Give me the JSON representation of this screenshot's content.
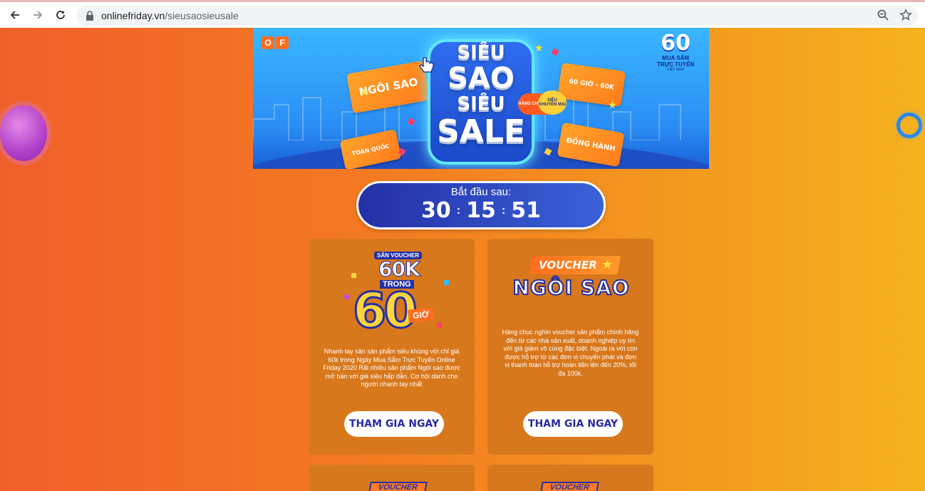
{
  "browser": {
    "url_host": "onlinefriday.vn",
    "url_path": "/sieusaosieusale",
    "icons": [
      "back-icon",
      "forward-icon",
      "reload-icon",
      "lock-icon",
      "zoom-icon",
      "star-icon"
    ]
  },
  "hero": {
    "title_line1": "SIÊU",
    "title_line2": "SAO",
    "title_line3": "SIÊU",
    "title_line4": "SALE",
    "ticket_1": "NGÔI SAO",
    "ticket_2": "60 GIỜ - 60K",
    "ticket_3": "TOÀN QUỐC",
    "ticket_4": "ĐỒNG HÀNH",
    "badge_1": "HÀNG CHÍNH HÃNG",
    "badge_2": "SIÊU KHUYẾN MẠI",
    "logo_of": [
      "O",
      "F"
    ],
    "logo_60": "60",
    "logo_60_sub1": "MUA SẮM",
    "logo_60_sub2": "TRỰC TUYẾN",
    "logo_60_sub3": "VIỆT NAM"
  },
  "countdown": {
    "label": "Bắt đầu sau:",
    "hours": "30",
    "minutes": "15",
    "seconds": "51",
    "separator": ":"
  },
  "cards": [
    {
      "logo_top": "SĂN VOUCHER",
      "logo_k": "60K",
      "logo_trong": "TRONG",
      "logo_big": "60",
      "logo_gio": "GIỜ",
      "description": "Nhanh tay săn sản phẩm siêu khủng với chỉ giá 60k trong Ngày Mua Sắm Trực Tuyến Online Friday 2020 Rất nhiều sản phẩm Ngôi sao được mở bán với giá siêu hấp dẫn. Cơ hội dành cho người nhanh tay nhất",
      "cta": "THAM GIA NGAY"
    },
    {
      "logo_voucher": "VOUCHER",
      "logo_ngoisao": "NGÔI SAO",
      "description": "Hàng chục nghìn voucher sản phẩm chính hãng đến từ các nhà sản xuất, doanh nghiệp uy tín với giá giảm vô cùng đặc biệt. Ngoài ra với còn được hỗ trợ từ các đơn vị chuyển phát và đơn vị thanh toán hỗ trợ hoàn tiền lên đến 20%, tối đa 100k.",
      "cta": "THAM GIA NGAY"
    },
    {
      "peek_label": "VOUCHER"
    },
    {
      "peek_label": "VOUCHER"
    }
  ],
  "colors": {
    "bg_left": "#f05f2a",
    "bg_right": "#f5b21e",
    "card": "#d8781c",
    "countdown": "#2430a6",
    "cta_text": "#2a2aa8"
  }
}
